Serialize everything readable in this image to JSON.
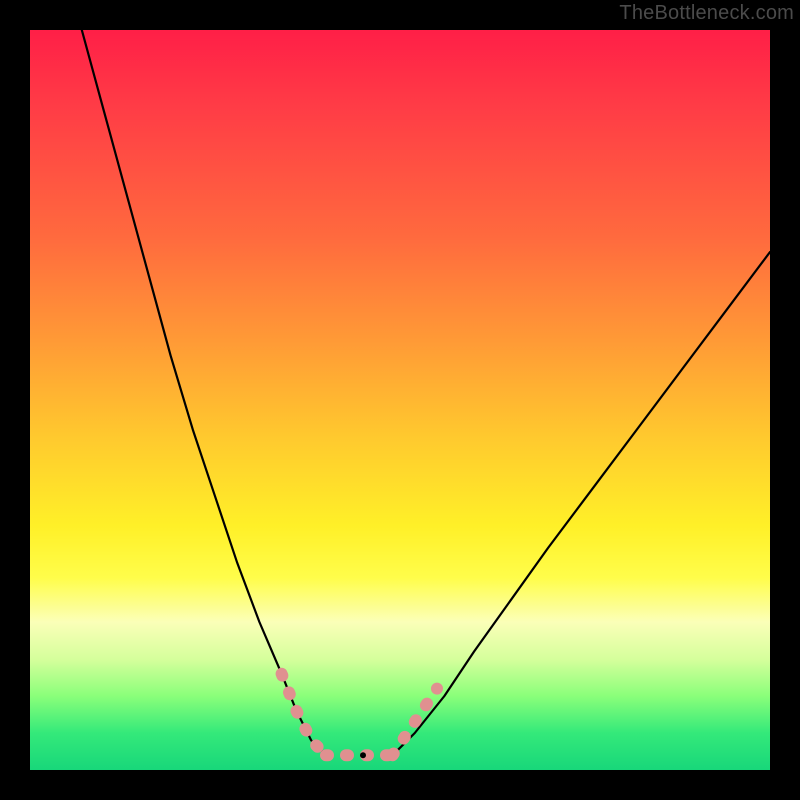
{
  "watermark": "TheBottleneck.com",
  "chart_data": {
    "type": "line",
    "title": "",
    "xlabel": "",
    "ylabel": "",
    "xlim": [
      0,
      100
    ],
    "ylim": [
      0,
      100
    ],
    "annotations": [],
    "gradient_stops": [
      {
        "pos": 0,
        "color": "#ff1f47"
      },
      {
        "pos": 28,
        "color": "#ff6a3e"
      },
      {
        "pos": 55,
        "color": "#ffc92e"
      },
      {
        "pos": 74,
        "color": "#fffd4a"
      },
      {
        "pos": 85,
        "color": "#d6ff9c"
      },
      {
        "pos": 100,
        "color": "#18d77a"
      }
    ],
    "series": [
      {
        "name": "left-branch",
        "color": "#000000",
        "x": [
          7,
          10,
          13,
          16,
          19,
          22,
          25,
          28,
          31,
          34,
          36,
          38,
          40
        ],
        "y": [
          100,
          89,
          78,
          67,
          56,
          46,
          37,
          28,
          20,
          13,
          8,
          4,
          2
        ]
      },
      {
        "name": "right-branch",
        "color": "#000000",
        "x": [
          49,
          52,
          56,
          60,
          65,
          70,
          76,
          82,
          88,
          94,
          100
        ],
        "y": [
          2,
          5,
          10,
          16,
          23,
          30,
          38,
          46,
          54,
          62,
          70
        ]
      },
      {
        "name": "valley-marker-left",
        "color": "#e09090",
        "x": [
          34,
          36,
          38,
          40
        ],
        "y": [
          13,
          8,
          4,
          2
        ]
      },
      {
        "name": "valley-floor-marker",
        "color": "#e09090",
        "x": [
          40,
          43,
          46,
          49
        ],
        "y": [
          2,
          2,
          2,
          2
        ]
      },
      {
        "name": "valley-marker-right",
        "color": "#e09090",
        "x": [
          49,
          51,
          53,
          55
        ],
        "y": [
          2,
          5,
          8,
          11
        ]
      }
    ],
    "minimum_point": {
      "x": 45,
      "y": 2
    }
  }
}
